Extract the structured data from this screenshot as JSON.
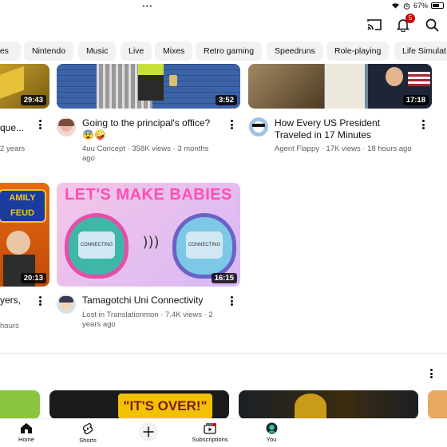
{
  "status": {
    "battery": "67%"
  },
  "header": {
    "notification_count": "5"
  },
  "chips": [
    "ries",
    "Nintendo",
    "Music",
    "Live",
    "Mixes",
    "Retro gaming",
    "Speedruns",
    "Role-playing",
    "Life Simulat"
  ],
  "videos": [
    {
      "title": "que...",
      "meta": "2 years",
      "duration": "29:43"
    },
    {
      "title": "Going to the principal's office? 😨🤪",
      "meta": "4uu Concept · 358K views · 3 months ago",
      "duration": "3:52"
    },
    {
      "title": "How Every US President Traveled in 17 Minutes",
      "meta": "Agent Flappy · 17K views · 18 hours ago",
      "duration": "17:18"
    },
    {
      "title": "yers,",
      "meta": "hours",
      "duration": "20:13",
      "thumb_text": "AMILY FEUD"
    },
    {
      "title": "Tamagotchi Uni Connectivity",
      "meta": "Lost in Translationmon · 7.4K views · 2 years ago",
      "duration": "16:15",
      "thumb_text": "LET'S MAKE BABIES",
      "device_text": "CONNECTING"
    }
  ],
  "shelf": {
    "thumb_text": "\"IT'S OVER!\""
  },
  "nav": {
    "home": "Home",
    "shorts": "Shorts",
    "subscriptions": "Subscriptions",
    "you": "You"
  }
}
